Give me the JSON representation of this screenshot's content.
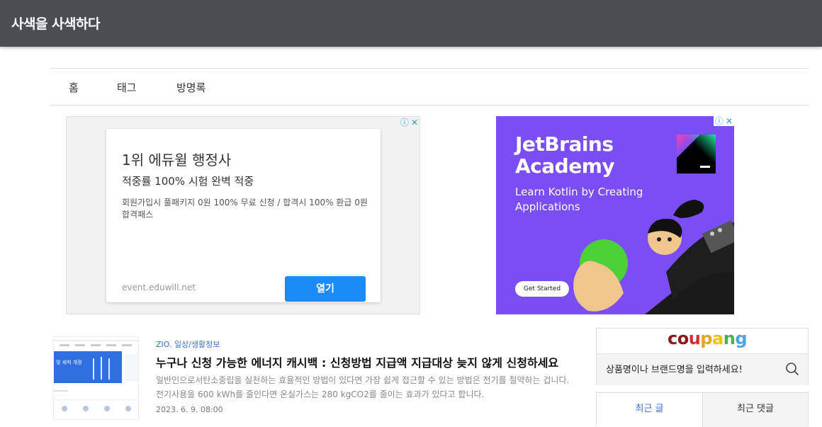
{
  "header": {
    "site_title": "사색을 사색하다"
  },
  "nav": {
    "items": [
      "홈",
      "태그",
      "방명록"
    ]
  },
  "ad_left": {
    "title": "1위 에듀윌 행정사",
    "subtitle": "적중률 100% 시험 완벽 적중",
    "description": "회원가입시 풀패키지 0원 100% 무료 신청 / 합격시 100% 환급 0원 합격패스",
    "url": "event.eduwill.net",
    "button": "열기"
  },
  "ad_right": {
    "title_line1": "JetBrains",
    "title_line2": "Academy",
    "subtitle_line1": "Learn Kotlin by Creating",
    "subtitle_line2": "Applications",
    "button": "Get Started",
    "brand_color": "#7b4ef5"
  },
  "post": {
    "category": "ZIO. 일상/생활정보",
    "title": "누구나 신청 가능한 에너지 캐시백 : 신청방법 지급액 지급대상 늦지 않게 신청하세요",
    "excerpt": "일반인으로서탄소중립을 실천하는 효율적인 방법이 있다면 가장 쉽게 접근할 수 있는 방법은 전기를 절약하는 겁니다. 전기사용을 600 kWh를 줄인다면 온실가스는 280 kgCO2를 줄이는 효과가 있다고 합니다.",
    "date": "2023. 6. 9. 08:00",
    "thumb_text": "및 세칙 개정"
  },
  "sidebar": {
    "coupang_logo": [
      "c",
      "o",
      "u",
      "p",
      "a",
      "n",
      "g"
    ],
    "coupang_colors": [
      "#8b1a1a",
      "#8b1a1a",
      "#d32f2f",
      "#e7a41c",
      "#f4c20d",
      "#4caf50",
      "#4fa3e0"
    ],
    "search_placeholder": "상품명이나 브랜드명을 입력하세요!",
    "tabs": [
      "최근 글",
      "최근 댓글"
    ],
    "accent": "#3d6fc7"
  }
}
